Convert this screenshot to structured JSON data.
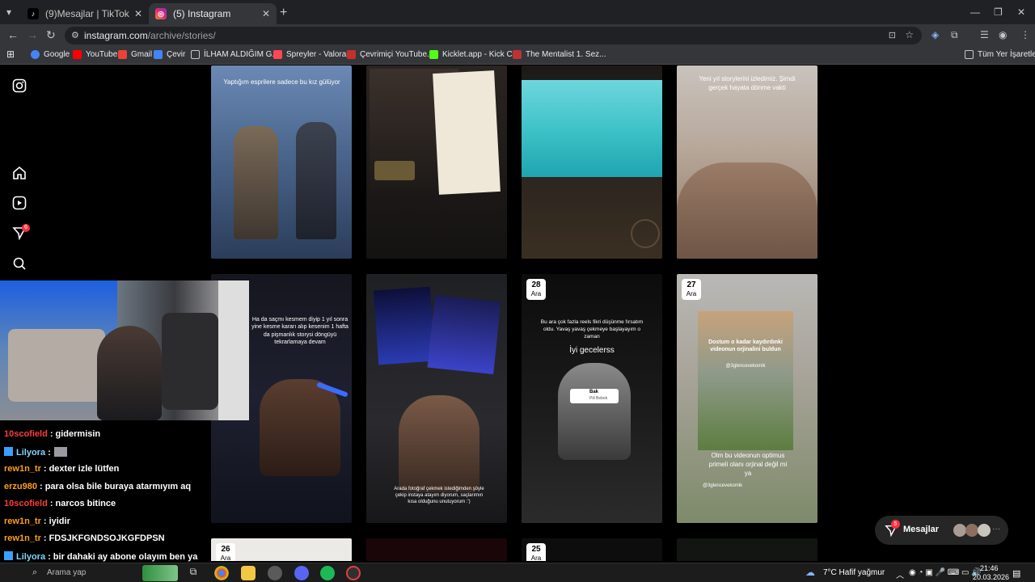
{
  "browser": {
    "tabs": [
      {
        "title": "(9)Mesajlar | TikTok",
        "active": false
      },
      {
        "title": "(5) Instagram",
        "active": true
      }
    ],
    "url_host": "instagram.com",
    "url_path": "/archive/stories/",
    "bookmarks": [
      {
        "label": "Google",
        "color": "#4285f4"
      },
      {
        "label": "YouTube",
        "color": "#ff0000"
      },
      {
        "label": "Gmail",
        "color": "#ea4335"
      },
      {
        "label": "Çevir",
        "color": "#4285f4"
      },
      {
        "label": "İLHAM ALDIĞIM G...",
        "color": "#c4c7c5"
      },
      {
        "label": "Spreyler - Valorant",
        "color": "#ff4655"
      },
      {
        "label": "Çevrimiçi YouTube...",
        "color": "#c4302b"
      },
      {
        "label": "Kicklet.app - Kick C...",
        "color": "#53fc18"
      },
      {
        "label": "The Mentalist 1. Sez...",
        "color": "#b33"
      }
    ],
    "all_bookmarks_label": "Tüm Yer İşaretleri"
  },
  "instagram": {
    "notification_count": "6",
    "stories": [
      {
        "caption": "Yaptığım esprilere sadece bu kız gülüyor"
      },
      {
        "caption": ""
      },
      {
        "caption": ""
      },
      {
        "caption": "Yeni yıl storylerini izledimiz. Şimdi gerçek hayata dönme vakti"
      },
      {
        "caption": "Ha da saçmı kesmem diyip 1 yıl sonra yine kesme kararı alıp kesenim 1 hafta da pişmanlık storysi döngüyü tekrarlamaya devam"
      },
      {
        "caption": "Arada fotoğraf çekmek istediğimden şöyle çekip instaya atayım diyorum, saçlarımın kısa olduğunu unutuyorum :')"
      },
      {
        "date_day": "28",
        "date_month": "Ara",
        "caption_top": "Bu ara çok fazla reels fikri düşünme fırsatım oldu. Yavaş yavaş çekmeye başlayayım o zaman",
        "caption_mid": "İyi gecelerss",
        "song_title": "Bak",
        "song_artist": "Pili Bebek"
      },
      {
        "date_day": "27",
        "date_month": "Ara",
        "caption_top": "Dostum o kadar kaydırdınki videonun orjinalini buldun",
        "handle": "@3glencevekomik",
        "caption_bottom": "Olm bu videonun optimus primeli olanı orjinal değil mi ya",
        "handle2": "@3glencevekomik"
      },
      {
        "date_day": "26",
        "date_month": "Ara"
      },
      {
        "caption": ""
      },
      {
        "date_day": "25",
        "date_month": "Ara"
      },
      {
        "caption": ""
      }
    ],
    "messages_label": "Mesajlar",
    "messages_badge": "5"
  },
  "chat": [
    {
      "user": "10scofield",
      "text": ": gidermisin",
      "color": "#ff3b3b"
    },
    {
      "user": "Lilyora",
      "text": ":",
      "color": "#7ed6ff"
    },
    {
      "user": "rew1n_tr",
      "text": ": dexter izle lütfen",
      "color": "#ff9f1a"
    },
    {
      "user": "erzu980",
      "text": ": para olsa bile buraya atarmıyım aq",
      "color": "#ff9f1a"
    },
    {
      "user": "10scofield",
      "text": ": narcos bitince",
      "color": "#ff3b3b"
    },
    {
      "user": "rew1n_tr",
      "text": ": iyidir",
      "color": "#ff9f1a"
    },
    {
      "user": "rew1n_tr",
      "text": ": FDSJKFGNDSOJKGFDPSN",
      "color": "#ff9f1a"
    },
    {
      "user": "Lilyora",
      "text": ": bir dahaki ay abone olayım ben ya",
      "color": "#7ed6ff"
    }
  ],
  "taskbar": {
    "search_placeholder": "Arama yap",
    "weather": "7°C  Hafif yağmur",
    "time": "21:46",
    "date": "20.03.2026"
  }
}
